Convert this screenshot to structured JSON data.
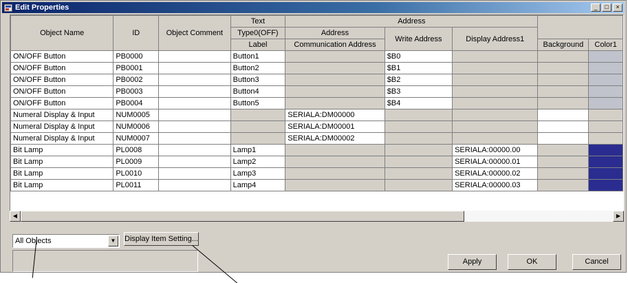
{
  "window": {
    "title": "Edit Properties",
    "buttons": {
      "minimize": "_",
      "maximize": "□",
      "close": "×"
    }
  },
  "headers": {
    "object_name": "Object Name",
    "id": "ID",
    "object_comment": "Object Comment",
    "text_group": "Text",
    "type0": "Type0(OFF)",
    "label": "Label",
    "address_group": "Address",
    "address": "Address",
    "communication_address": "Communication Address",
    "write_address": "Write Address",
    "display_address1": "Display Address1",
    "background": "Background",
    "color1": "Color1"
  },
  "rows": [
    {
      "name": "ON/OFF Button",
      "id": "PB0000",
      "comment": "",
      "label": "Button1",
      "address": "",
      "write": "$B0",
      "display": ""
    },
    {
      "name": "ON/OFF Button",
      "id": "PB0001",
      "comment": "",
      "label": "Button2",
      "address": "",
      "write": "$B1",
      "display": ""
    },
    {
      "name": "ON/OFF Button",
      "id": "PB0002",
      "comment": "",
      "label": "Button3",
      "address": "",
      "write": "$B2",
      "display": ""
    },
    {
      "name": "ON/OFF Button",
      "id": "PB0003",
      "comment": "",
      "label": "Button4",
      "address": "",
      "write": "$B3",
      "display": ""
    },
    {
      "name": "ON/OFF Button",
      "id": "PB0004",
      "comment": "",
      "label": "Button5",
      "address": "",
      "write": "$B4",
      "display": ""
    },
    {
      "name": "Numeral Display & Input",
      "id": "NUM0005",
      "comment": "",
      "label": "",
      "address": "SERIALA:DM00000",
      "write": "",
      "display": ""
    },
    {
      "name": "Numeral Display & Input",
      "id": "NUM0006",
      "comment": "",
      "label": "",
      "address": "SERIALA:DM00001",
      "write": "",
      "display": ""
    },
    {
      "name": "Numeral Display & Input",
      "id": "NUM0007",
      "comment": "",
      "label": "",
      "address": "SERIALA:DM00002",
      "write": "",
      "display": ""
    },
    {
      "name": "Bit Lamp",
      "id": "PL0008",
      "comment": "",
      "label": "Lamp1",
      "address": "",
      "write": "",
      "display": "SERIALA:00000.00"
    },
    {
      "name": "Bit Lamp",
      "id": "PL0009",
      "comment": "",
      "label": "Lamp2",
      "address": "",
      "write": "",
      "display": "SERIALA:00000.01"
    },
    {
      "name": "Bit Lamp",
      "id": "PL0010",
      "comment": "",
      "label": "Lamp3",
      "address": "",
      "write": "",
      "display": "SERIALA:00000.02"
    },
    {
      "name": "Bit Lamp",
      "id": "PL0011",
      "comment": "",
      "label": "Lamp4",
      "address": "",
      "write": "",
      "display": "SERIALA:00000.03"
    }
  ],
  "colors": {
    "button_color1": "#c0c3cc",
    "lamp_color1": "#2a2d8f",
    "face": "#d4d0c8"
  },
  "controls": {
    "filter_value": "All Objects",
    "display_item_setting": "Display Item Setting...",
    "apply": "Apply",
    "ok": "OK",
    "cancel": "Cancel"
  }
}
